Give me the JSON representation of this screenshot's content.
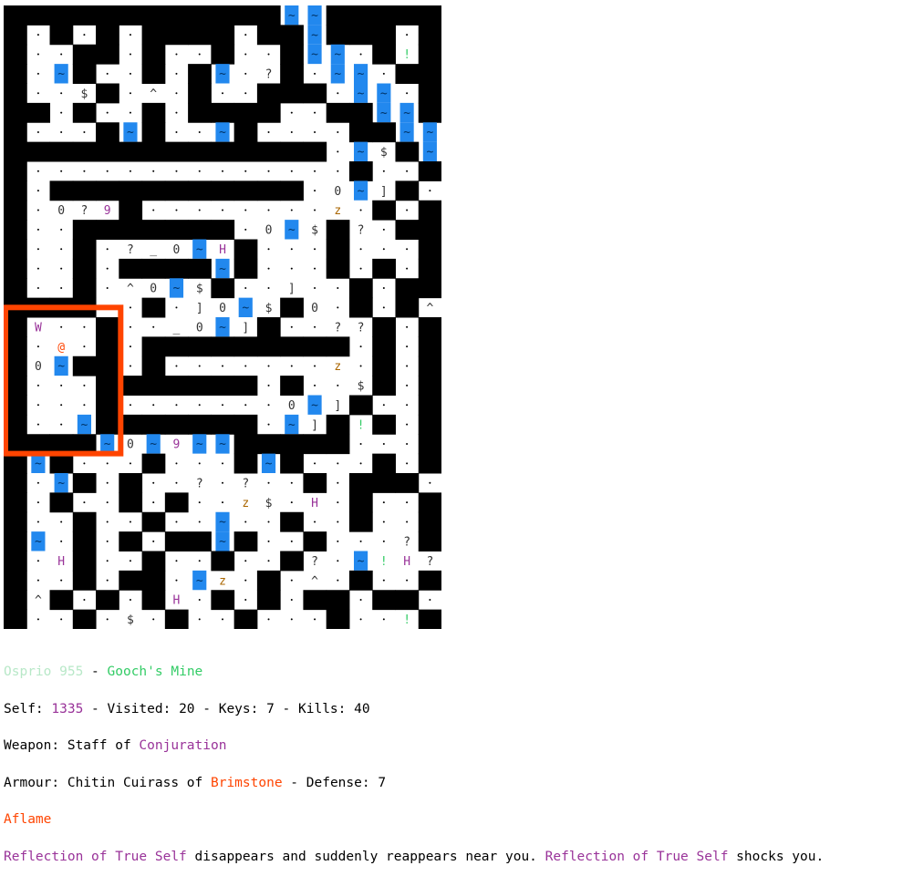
{
  "status": {
    "player_name": "Osprio 955",
    "sep": " - ",
    "location": "Gooch's Mine",
    "self_label": "Self: ",
    "self_value": "1335",
    "stats_rest": " - Visited: 20 - Keys: 7 - Kills: 40",
    "weapon_label": "Weapon: Staff of ",
    "weapon_school": "Conjuration",
    "armour_label": "Armour: Chitin Cuirass of ",
    "armour_element": "Brimstone",
    "armour_defense": " - Defense: 7",
    "condition": "Aflame",
    "msg_monster_1": "Reflection of True Self",
    "msg_mid": " disappears and suddenly reappears near you. ",
    "msg_monster_2": "Reflection of True Self",
    "msg_end": " shocks you."
  },
  "colors": {
    "wall": "#000000",
    "floor": "#ffffff",
    "water": "#2288ee",
    "fire": "#ff4400",
    "lava": "#ff6600",
    "blood": "#880000",
    "gold": "#ffcc00",
    "acid": "#00dd00",
    "plant": "#33cc66",
    "potion": "#cc0000",
    "monster": "#993399",
    "item": "#333333"
  },
  "map_legend": {
    "player": "@",
    "wall": "#",
    "water": "~",
    "trap": "^",
    "gold": "$",
    "scroll": "?",
    "potion": "!",
    "armour": "]",
    "ring": "0"
  },
  "map_rows": [
    "############~~#####",
    "#.#.#.####.##~###.#",
    "#..##.#..#..#~~.#!#",
    "#.~#..#.#~.?#.~~.##",
    "#..$#.^.#..###.~~.#",
    "##.#..#.####..##~~#",
    "#...#~#..~#....##~~",
    "##############.~$#~",
    "#..............#..#",
    "#.###########.0~]#.",
    "#.0?9#........z.#.#",
    "#..#######.0~$#?.##",
    "#..#.?_0~H#...#...#",
    "#..#.####~#...#.#.#",
    "#..#.^0~$#..]..#.##",
    "####..#.]0~$#0.#.#^",
    "#W..#.._0~]#..??#.#",
    "#.@.#.#########.#.#",
    "#0~##.#.......z.#.#",
    "#...#######.#..$#.#",
    "#...#.......0~]#..#",
    "#..~#######.~]#!#.#",
    "####~0~9~~#####...#",
    "#~#...#...#~#...#.#",
    "#.~#.#..?.?..#.###.",
    "#.#..#.#..z$.H.#..#",
    "#..#..#..~..#..#..#",
    "#~.#.#.##~#..#...?#",
    "#.H#..#..#..#?.~!H?",
    "#..#.##.~z.#.^.#..#",
    "#^#.#.#H.#.#.##.##.",
    "#..#.$.#..#...#..!#"
  ]
}
